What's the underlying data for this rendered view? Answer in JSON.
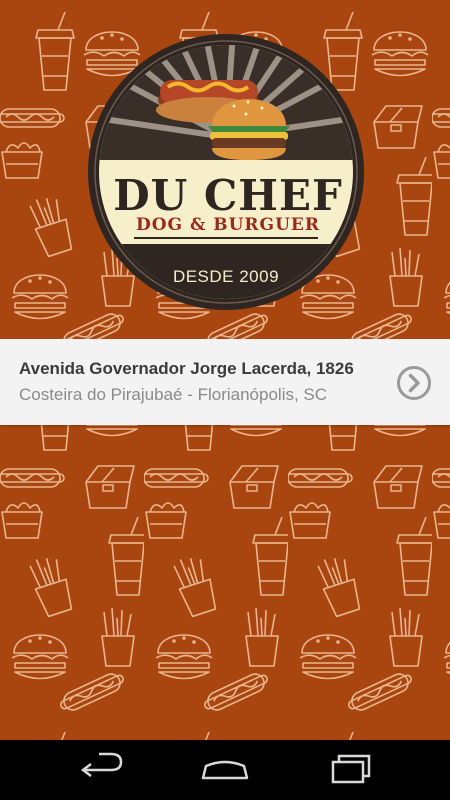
{
  "logo": {
    "brand_name": "DU CHEF",
    "tagline": "DOG & BURGUER",
    "since": "DESDE 2009"
  },
  "address": {
    "street": "Avenida Governador Jorge Lacerda, 1826",
    "neighborhood": "Costeira do Pirajubaé - Florianópolis, SC",
    "action_icon": "chevron-right-circle-icon"
  },
  "navbar": {
    "back_icon": "back-icon",
    "home_icon": "home-icon",
    "recents_icon": "recents-icon"
  },
  "colors": {
    "background": "#a9460f",
    "pattern_line": "#e9b58d",
    "logo_dark": "#2f2622",
    "logo_cream": "#f6efc9",
    "tagline_red": "#9c2a1c",
    "card": "#f3f3f3"
  }
}
